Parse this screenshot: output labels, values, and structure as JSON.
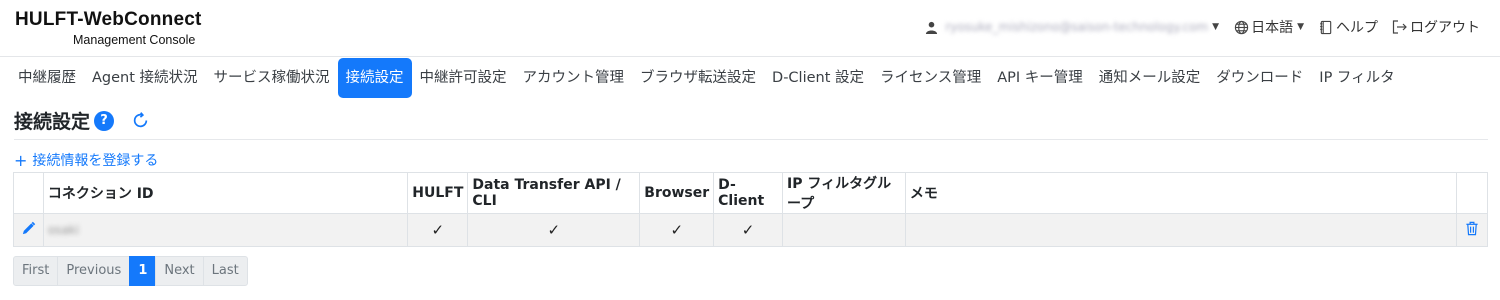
{
  "app": {
    "title": "HULFT-WebConnect",
    "subtitle": "Management Console"
  },
  "header": {
    "user_email": "ryosuke_mishizono@saison-technology.com",
    "language": "日本語",
    "help": "ヘルプ",
    "logout": "ログアウト"
  },
  "nav": {
    "tabs": [
      {
        "label": "中継履歴"
      },
      {
        "label": "Agent 接続状況"
      },
      {
        "label": "サービス稼働状況"
      },
      {
        "label": "接続設定"
      },
      {
        "label": "中継許可設定"
      },
      {
        "label": "アカウント管理"
      },
      {
        "label": "ブラウザ転送設定"
      },
      {
        "label": "D-Client 設定"
      },
      {
        "label": "ライセンス管理"
      },
      {
        "label": "API キー管理"
      },
      {
        "label": "通知メール設定"
      },
      {
        "label": "ダウンロード"
      },
      {
        "label": "IP フィルタ"
      }
    ],
    "active_index": 3
  },
  "page": {
    "title": "接続設定",
    "help_badge": "?",
    "add_link": "接続情報を登録する"
  },
  "table": {
    "headers": {
      "connection_id": "コネクション ID",
      "hulft": "HULFT",
      "api": "Data Transfer API / CLI",
      "browser": "Browser",
      "dclient": "D-Client",
      "ip_group": "IP フィルタグループ",
      "memo": "メモ"
    },
    "rows": [
      {
        "connection_id": "osaki",
        "hulft": "✓",
        "api": "✓",
        "browser": "✓",
        "dclient": "✓",
        "ip_group": "",
        "memo": ""
      }
    ]
  },
  "pagination": {
    "first": "First",
    "previous": "Previous",
    "current": "1",
    "next": "Next",
    "last": "Last"
  },
  "colors": {
    "accent": "#1479fb",
    "row_bg": "#f2f2f2",
    "border": "#dee2e6"
  }
}
